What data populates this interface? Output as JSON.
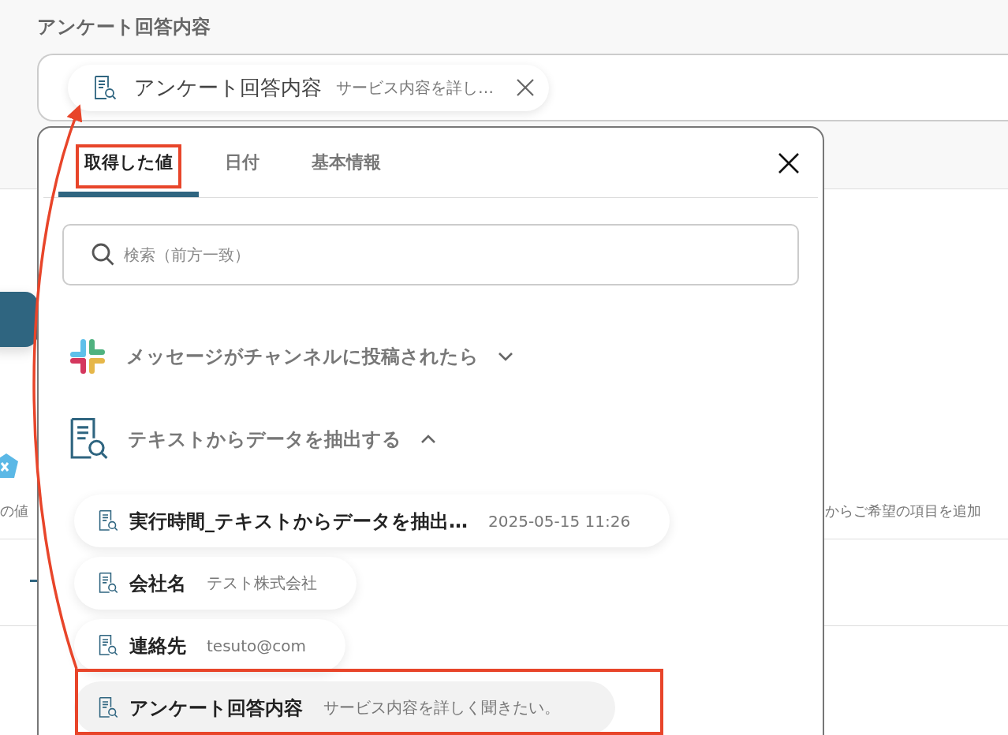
{
  "field": {
    "label": "アンケート回答内容",
    "chip": {
      "name": "アンケート回答内容",
      "value": "サービス内容を詳し…"
    }
  },
  "background": {
    "left_fragment": "の値",
    "right_fragment": "からご希望の項目を追加"
  },
  "popup": {
    "tabs": [
      {
        "label": "取得した値",
        "selected": true
      },
      {
        "label": "日付",
        "selected": false
      },
      {
        "label": "基本情報",
        "selected": false
      }
    ],
    "search": {
      "placeholder": "検索（前方一致）"
    },
    "groups": [
      {
        "kind": "slack",
        "title": "メッセージがチャンネルに投稿されたら",
        "expanded": false
      },
      {
        "kind": "extract",
        "title": "テキストからデータを抽出する",
        "expanded": true,
        "items": [
          {
            "name": "実行時間_テキストからデータを抽出…",
            "value": "2025-05-15 11:26",
            "selected": false
          },
          {
            "name": "会社名",
            "value": "テスト株式会社",
            "selected": false
          },
          {
            "name": "連絡先",
            "value": "tesuto@com",
            "selected": false
          },
          {
            "name": "アンケート回答内容",
            "value": "サービス内容を詳しく聞きたい。",
            "selected": true
          }
        ]
      }
    ]
  }
}
